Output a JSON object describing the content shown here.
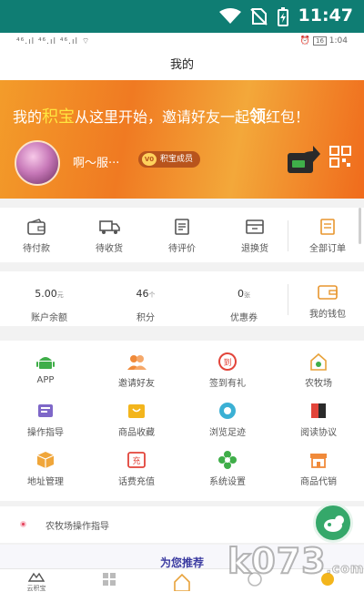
{
  "status": {
    "time": "11:47",
    "inner_time": "1:04",
    "inner_left": "⁴⁶.ıl ⁴⁶.ıl ⁴⁶.ıl ⌔",
    "inner_badge": "16"
  },
  "header": {
    "title": "我的"
  },
  "banner": {
    "slogan_pre": "我的",
    "slogan_hl": "积宝",
    "slogan_post": "从这里开始，邀请好友一起",
    "slogan_hl2": "领",
    "slogan_end": "红包！",
    "username": "啊～服···",
    "member_tag": "积宝成员",
    "member_level": "V0"
  },
  "orders": [
    {
      "label": "待付款",
      "icon": "wallet-card-icon"
    },
    {
      "label": "待收货",
      "icon": "truck-icon"
    },
    {
      "label": "待评价",
      "icon": "document-icon"
    },
    {
      "label": "退换货",
      "icon": "return-box-icon"
    },
    {
      "label": "全部订单",
      "icon": "all-orders-icon"
    }
  ],
  "wallet": [
    {
      "value": "5.00",
      "unit": "元",
      "label": "账户余额"
    },
    {
      "value": "46",
      "unit": "个",
      "label": "积分"
    },
    {
      "value": "0",
      "unit": "张",
      "label": "优惠券"
    },
    {
      "value": "",
      "unit": "",
      "label": "我的钱包"
    }
  ],
  "grid": [
    {
      "label": "APP",
      "icon": "android-icon",
      "color": "#3fae49"
    },
    {
      "label": "邀请好友",
      "icon": "people-icon",
      "color": "#f08a3a"
    },
    {
      "label": "签到有礼",
      "icon": "checkin-icon",
      "color": "#e2443a"
    },
    {
      "label": "农牧场",
      "icon": "farm-icon",
      "color": "#e8a23a"
    },
    {
      "label": "操作指导",
      "icon": "guide-icon",
      "color": "#7e67c8"
    },
    {
      "label": "商品收藏",
      "icon": "cart-icon",
      "color": "#f3b51c"
    },
    {
      "label": "浏览足迹",
      "icon": "footprint-icon",
      "color": "#3bb0d4"
    },
    {
      "label": "阅读协议",
      "icon": "book-icon",
      "color": "#e2443a"
    },
    {
      "label": "地址管理",
      "icon": "parcel-icon",
      "color": "#f0a63a"
    },
    {
      "label": "话费充值",
      "icon": "recharge-icon",
      "color": "#e2443a"
    },
    {
      "label": "系统设置",
      "icon": "flower-settings-icon",
      "color": "#3fae49"
    },
    {
      "label": "商品代销",
      "icon": "store-icon",
      "color": "#f08a3a"
    }
  ],
  "guide": {
    "label": "农牧场操作指导"
  },
  "recommend": {
    "title": "为您推荐"
  },
  "tabs": [
    {
      "label": "云积宝",
      "icon": "home-icon"
    },
    {
      "label": "",
      "icon": "category-icon"
    },
    {
      "label": "",
      "icon": "farm-tab-icon"
    },
    {
      "label": "",
      "icon": "cart-tab-icon"
    },
    {
      "label": "",
      "icon": "me-tab-icon"
    }
  ],
  "watermark": {
    "text": "k073",
    "suffix": ".com"
  },
  "colors": {
    "statusbar": "#0f7d73",
    "banner": "#f07a22",
    "accent": "#f08a3a"
  }
}
